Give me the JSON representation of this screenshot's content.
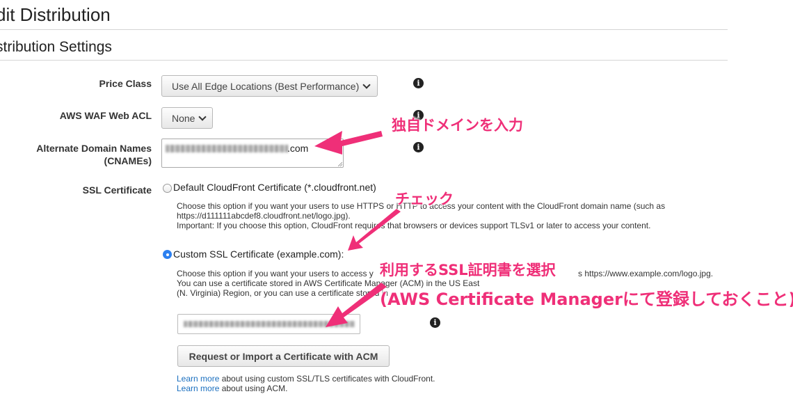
{
  "page": {
    "title": "dit Distribution",
    "section_title": "stribution Settings"
  },
  "price_class": {
    "label": "Price Class",
    "value": "Use All Edge Locations (Best Performance)"
  },
  "waf": {
    "label": "AWS WAF Web ACL",
    "value": "None"
  },
  "cnames": {
    "label_line1": "Alternate Domain Names",
    "label_line2": "(CNAMEs)",
    "value_suffix": ".com"
  },
  "ssl": {
    "label": "SSL Certificate",
    "default_option": {
      "label": "Default CloudFront Certificate (*.cloudfront.net)",
      "selected": false,
      "desc_line1": "Choose this option if you want your users to use HTTPS or HTTP to access your content with the CloudFront domain name (such as",
      "desc_line2": "https://d111111abcdef8.cloudfront.net/logo.jpg).",
      "desc_line3": "Important: If you choose this option, CloudFront requires that browsers or devices support TLSv1 or later to access your content."
    },
    "custom_option": {
      "label": "Custom SSL Certificate (example.com):",
      "selected": true,
      "desc_line1a": "Choose this option if you want your users to access y",
      "desc_line1b": "s https://www.example.com/logo.jpg.",
      "desc_line2": "You can use a certificate stored in AWS Certificate Manager (ACM) in the US East",
      "desc_line3": "(N. Virginia) Region, or you can use a certificate stored in"
    },
    "request_button": "Request or Import a Certificate with ACM",
    "learn_more_1": "Learn more",
    "learn_more_1_rest": " about using custom SSL/TLS certificates with CloudFront.",
    "learn_more_2": "Learn more",
    "learn_more_2_rest": " about using ACM."
  },
  "annotations": {
    "domain": "独自ドメインを入力",
    "check": "チェック",
    "select_line1": "利用するSSL証明書を選択",
    "select_line2": "(AWS Certificate Managerにて登録しておくこと)"
  },
  "colors": {
    "annotation": "#ef2f78",
    "link": "#1a6fbf",
    "radio_selected": "#2c80f0"
  }
}
